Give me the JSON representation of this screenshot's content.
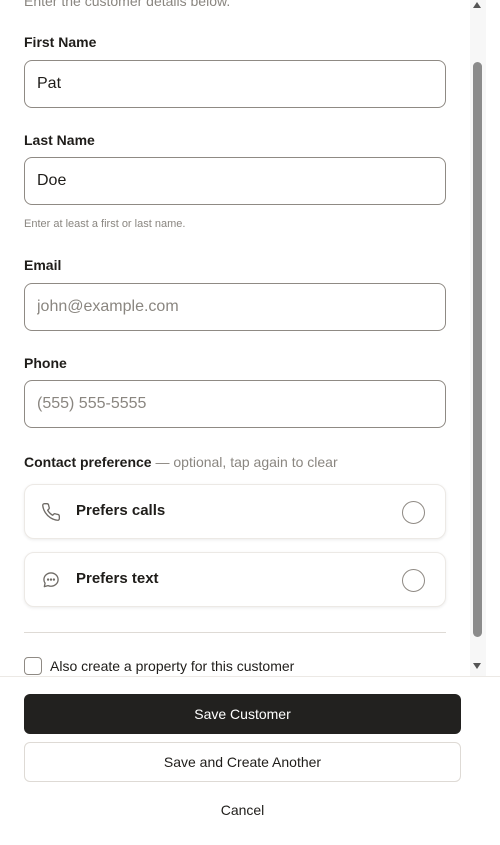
{
  "form": {
    "subtitle": "Enter the customer details below.",
    "first_name": {
      "label": "First Name",
      "value": "Pat",
      "placeholder": ""
    },
    "last_name": {
      "label": "Last Name",
      "value": "Doe",
      "placeholder": ""
    },
    "name_helper": "Enter at least a first or last name.",
    "email": {
      "label": "Email",
      "value": "",
      "placeholder": "john@example.com"
    },
    "phone": {
      "label": "Phone",
      "value": "",
      "placeholder": "(555) 555-5555"
    },
    "contact_preference": {
      "label": "Contact preference",
      "hint": "— optional, tap again to clear",
      "options": [
        {
          "label": "Prefers calls",
          "icon": "phone-icon",
          "selected": false
        },
        {
          "label": "Prefers text",
          "icon": "chat-bubble-icon",
          "selected": false
        }
      ]
    },
    "create_property": {
      "label": "Also create a property for this customer",
      "checked": false
    }
  },
  "footer": {
    "save_label": "Save Customer",
    "save_another_label": "Save and Create Another",
    "cancel_label": "Cancel"
  },
  "colors": {
    "primary_button": "#22211f",
    "border": "#8f8a84",
    "muted_text": "#8a8680"
  }
}
